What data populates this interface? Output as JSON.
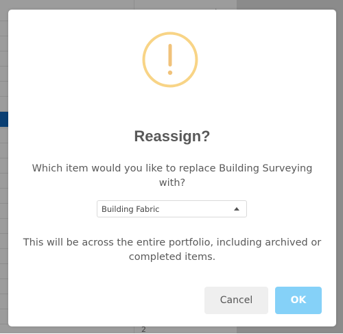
{
  "background": {
    "cell_text": "2"
  },
  "dialog": {
    "icon": "exclamation-icon",
    "icon_color": "#f8d486",
    "title": "Reassign?",
    "question": "Which item would you like to replace Building Surveying with?",
    "select": {
      "value": "Building Fabric"
    },
    "note": "This will be across the entire portfolio, including archived or completed items.",
    "buttons": {
      "cancel_label": "Cancel",
      "ok_label": "OK",
      "ok_color": "#85d1f8"
    }
  }
}
